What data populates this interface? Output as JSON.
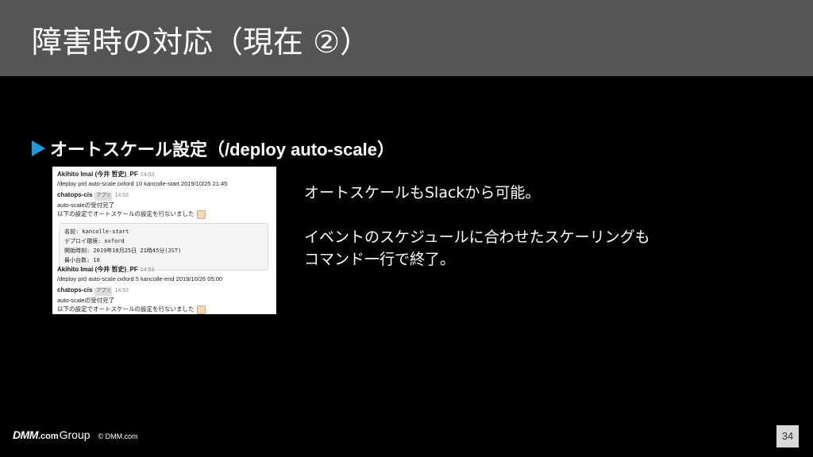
{
  "header": {
    "title": "障害時の対応（現在 ②）"
  },
  "bullet": {
    "text": "オートスケール設定（/deploy auto-scale）"
  },
  "slack": {
    "messages": [
      {
        "user": "Akihito Imai (今井 哲史)_PF",
        "time": "14:53",
        "text": "/deploy prd auto-scale oxford 10 kancolle-start 2019/10/25 21:45"
      },
      {
        "user": "chatops-cis",
        "badge": "アプリ",
        "time": "14:53",
        "text": "auto-scaleの受付完了",
        "text2": "以下の設定でオートスケールの設定を行ないました"
      },
      {
        "user": "Akihito Imai (今井 哲史)_PF",
        "time": "14:53",
        "text": "/deploy prd auto-scale oxford 5 kancolle-end 2019/10/26 05:00"
      },
      {
        "user": "chatops-cis",
        "badge": "アプリ",
        "time": "14:53",
        "text": "auto-scaleの受付完了",
        "text2": "以下の設定でオートスケールの設定を行ないました"
      }
    ],
    "code": [
      "名前: kancolle-start",
      "デプロイ環境: oxford",
      "開始時刻: 2019年10月25日 21時45分(JST)",
      "最小台数: 10"
    ]
  },
  "description": {
    "line1": "オートスケールもSlackから可能。",
    "line2": "イベントのスケジュールに合わせたスケーリングも",
    "line3": "コマンド一行で終了。"
  },
  "footer": {
    "logo_dmm": "DMM",
    "logo_com": ".com",
    "logo_group": "Group",
    "copyright": "© DMM.com",
    "page_number": "34"
  },
  "colors": {
    "header_bg": "#555555",
    "bullet_accent": "#1e9bd7",
    "page_num_bg": "#d9d9d9"
  }
}
